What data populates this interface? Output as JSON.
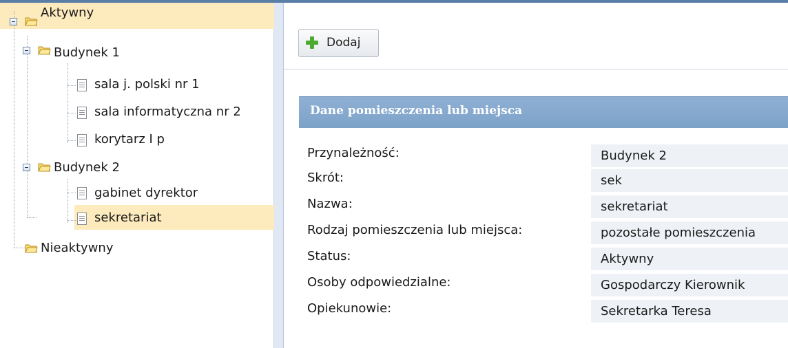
{
  "tree": {
    "root_active": "Aktywny",
    "building1": {
      "label": "Budynek 1",
      "items": [
        "sala j. polski nr 1",
        "sala informatyczna nr 2",
        "korytarz I p"
      ]
    },
    "building2": {
      "label": "Budynek 2",
      "items": [
        "gabinet dyrektor",
        "sekretariat"
      ]
    },
    "root_inactive": "Nieaktywny",
    "selected": "sekretariat"
  },
  "toolbar": {
    "add_label": "Dodaj"
  },
  "details": {
    "title": "Dane pomieszczenia lub miejsca",
    "fields": [
      {
        "label": "Przynależność:",
        "value": "Budynek 2"
      },
      {
        "label": "Skrót:",
        "value": "sek"
      },
      {
        "label": "Nazwa:",
        "value": "sekretariat"
      },
      {
        "label": "Rodzaj pomieszczenia lub miejsca:",
        "value": "pozostałe pomieszczenia"
      },
      {
        "label": "Status:",
        "value": "Aktywny"
      },
      {
        "label": "Osoby odpowiedzialne:",
        "value": "Gospodarczy Kierownik"
      },
      {
        "label": "Opiekunowie:",
        "value": "Sekretarka Teresa"
      }
    ]
  },
  "colors": {
    "header": "#7da2c9",
    "selection": "#fdeabd",
    "value_bg": "#eef2f6",
    "add_icon": "#4caa2e"
  },
  "icons": [
    "collapse-icon",
    "folder-icon",
    "document-icon",
    "plus-icon"
  ]
}
